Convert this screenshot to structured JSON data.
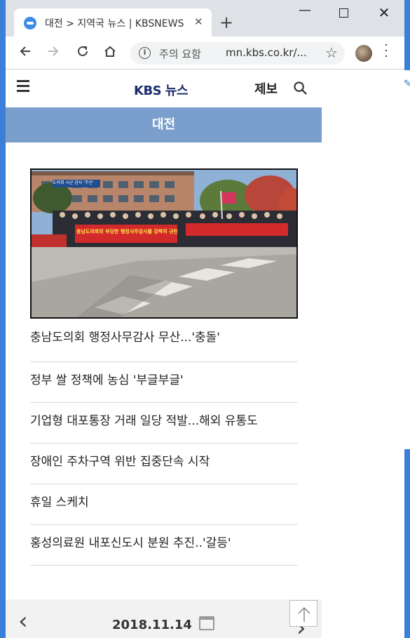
{
  "browser": {
    "tab_title": "대전 > 지역국 뉴스 | KBSNEWS",
    "tab_close": "✕",
    "new_tab": "+",
    "security_label": "주의 요함",
    "url": "mn.kbs.co.kr/..."
  },
  "site": {
    "logo": "KBS 뉴스",
    "report_link": "제보",
    "region": "대전"
  },
  "news": {
    "image_banner_sign": "도의회 시군 감사 '무산'",
    "image_banner_main": "충남도의회의 부당한 행정사무감사를 강력히 규탄한다!",
    "items": [
      "충남도의회 행정사무감사 무산...'충돌'",
      "정부 쌀 정책에 농심 '부글부글'",
      "기업형 대포통장 거래 일당 적발...해외 유통도",
      "장애인 주차구역 위반 집중단속 시작",
      "휴일 스케치",
      "홍성의료원 내포신도시 분원 추진..'갈등'"
    ]
  },
  "date_nav": {
    "date": "2018.11.14",
    "prev": "‹",
    "next": "›"
  }
}
